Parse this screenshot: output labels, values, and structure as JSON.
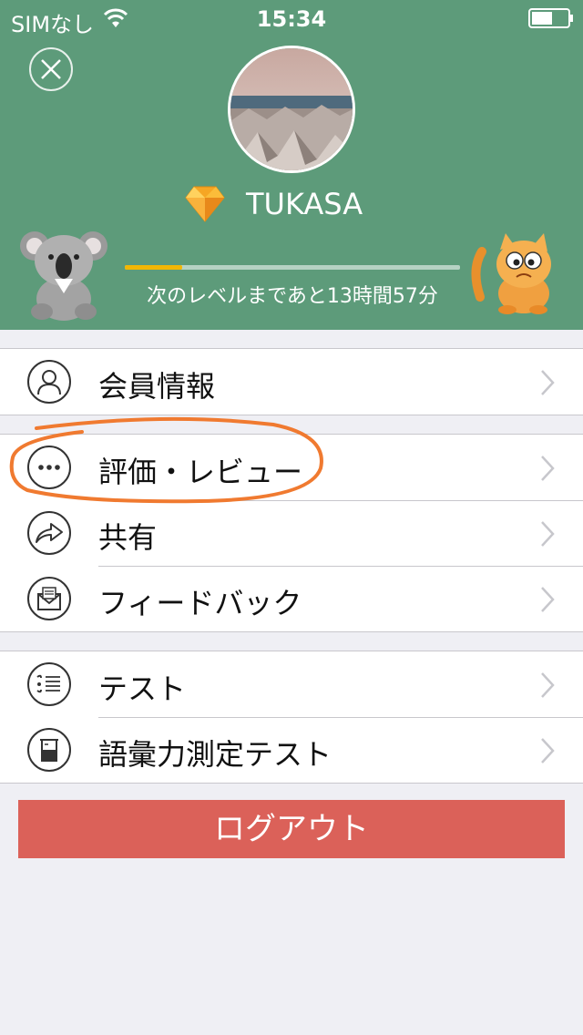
{
  "status_bar": {
    "carrier": "SIMなし",
    "time": "15:34"
  },
  "profile": {
    "username": "TUKASA",
    "level_progress": 0.17,
    "level_text": "次のレベルまであと13時間57分"
  },
  "menu_groups": [
    {
      "items": [
        {
          "label": "会員情報",
          "icon": "person-icon"
        }
      ]
    },
    {
      "items": [
        {
          "label": "評価・レビュー",
          "icon": "more-dots-icon"
        },
        {
          "label": "共有",
          "icon": "share-arrow-icon"
        },
        {
          "label": "フィードバック",
          "icon": "mail-icon"
        }
      ]
    },
    {
      "items": [
        {
          "label": "テスト",
          "icon": "list-icon"
        },
        {
          "label": "語彙力測定テスト",
          "icon": "beaker-icon"
        }
      ]
    }
  ],
  "logout_label": "ログアウト",
  "colors": {
    "header": "#5d9b7a",
    "logout": "#db6159",
    "progress": "#f2b705",
    "annotation": "#f07a30"
  }
}
